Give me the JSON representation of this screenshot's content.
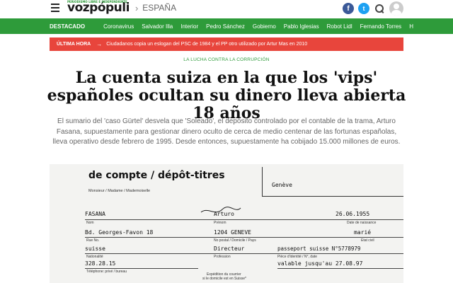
{
  "header": {
    "logo_text": "vozpópuli",
    "logo_tagline": "PERIODISMO LIBRE E INDEPENDIENTE",
    "section": "ESPAÑA",
    "facebook_glyph": "f",
    "twitter_glyph": "t",
    "icons": [
      "menu-icon",
      "facebook-icon",
      "twitter-icon",
      "search-icon",
      "user-avatar-icon"
    ]
  },
  "nav": {
    "featured_label": "DESTACADO",
    "items": [
      "Coronavirus",
      "Salvador Illa",
      "Interior",
      "Pedro Sánchez",
      "Gobierno",
      "Pablo Iglesias",
      "Robot Lidl",
      "Fernando Torres",
      "H"
    ]
  },
  "breaking": {
    "label": "ÚLTIMA HORA",
    "arrow": "→",
    "text": "Ciudadanos copia un eslogan del PSC de 1984 y el PP otro utilizado por Artur Mas en 2010"
  },
  "article": {
    "kicker": "LA LUCHA CONTRA LA CORRUPCIÓN",
    "title": "La cuenta suiza en la que los 'vips' españoles ocultan su dinero lleva abierta 18 años",
    "subtitle": "El sumario del 'caso Gürtel' desvela que 'Soleado', el depósito controlado por el contable de la trama, Arturo Fasana, supuestamente para gestionar dinero oculto de cerca de medio centenar de las fortunas españolas, lleva operativo desde febrero de 1995. Desde entonces, supuestamente ha cobijado 15.000 millones de euros."
  },
  "document": {
    "title": "de compte / dépôt-titres",
    "subtitle": "Monsieur / Madame / Mademoiselle",
    "box_value": "Genève",
    "row1": {
      "surname": "FASANA",
      "firstname": "Arturo",
      "dob": "26.06.1955",
      "lbl_name": "Nom",
      "lbl_first": "Prénom",
      "lbl_dob": "Date de naissance"
    },
    "row2": {
      "street": "Bd. Georges-Favon 18",
      "city": "1204 GENEVE",
      "status": "marié",
      "lbl_street": "Rue No.",
      "lbl_city": "No postal / Domicile / Pays",
      "lbl_status": "Etat civil"
    },
    "row3": {
      "nationality": "suisse",
      "profession": "Directeur",
      "id_doc": "passeport suisse N°5778979",
      "lbl_nat": "Nationalité",
      "lbl_prof": "Profession",
      "lbl_id": "Pièce d'identité / N°, date"
    },
    "row4": {
      "phone": "328.28.15",
      "valid": "valable jusqu'au 27.08.97",
      "lbl_phone": "Téléphone: privé / bureau",
      "expedition_1": "Expédition du courrier",
      "expedition_2": "si le domicile est en Suisse*"
    }
  }
}
